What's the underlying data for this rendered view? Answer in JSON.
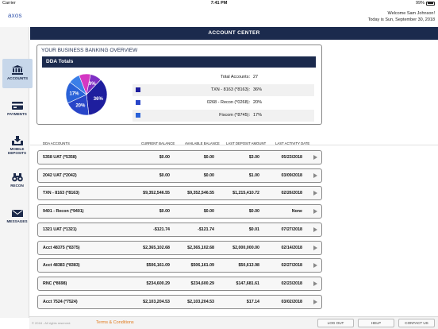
{
  "status_bar": {
    "carrier": "Carrier",
    "time": "7:41 PM",
    "battery": "99%"
  },
  "header": {
    "logo": "axos",
    "welcome_line1": "Welcome Sam Johnson!",
    "welcome_line2": "Today is Sun, September 30, 2018"
  },
  "nav": [
    {
      "label": "ACCOUNTS",
      "icon": "bank-icon",
      "active": true
    },
    {
      "label": "PAYMENTS",
      "icon": "payments-icon",
      "active": false
    },
    {
      "label": "MOBILE DEPOSITS",
      "icon": "mobile-deposit-icon",
      "active": false
    },
    {
      "label": "RECON",
      "icon": "binoculars-icon",
      "active": false
    },
    {
      "label": "MESSAGES",
      "icon": "envelope-icon",
      "active": false
    }
  ],
  "page_title": "ACCOUNT CENTER",
  "overview": {
    "title": "YOUR BUSINESS BANKING OVERVIEW",
    "section": "DDA Totals",
    "pie": [
      {
        "label": "9%",
        "value": 9,
        "color": "#7e2fc4"
      },
      {
        "label": "36%",
        "value": 36,
        "color": "#1e1e9e"
      },
      {
        "label": "20%",
        "value": 20,
        "color": "#2845c8"
      },
      {
        "label": "17%",
        "value": 17,
        "color": "#2a62d8"
      },
      {
        "label": "",
        "value": 9,
        "color": "#3b7fe8"
      },
      {
        "label": "",
        "value": 9,
        "color": "#d437c2"
      }
    ],
    "totals": [
      {
        "label": "Total Accounts:",
        "value": "27",
        "color": ""
      },
      {
        "label": "TXN - 8163 (*8163):",
        "value": "36%",
        "color": "#1e1e9e"
      },
      {
        "label": "0268 - Recon (*0268):",
        "value": "20%",
        "color": "#2845c8"
      },
      {
        "label": "Fiscom (*8745):",
        "value": "17%",
        "color": "#2a62d8"
      }
    ]
  },
  "columns": {
    "name": "DDA ACCOUNTS",
    "balance": "CURRENT BALANCE",
    "available": "AVAILABLE BALANCE",
    "deposit": "LAST DEPOSIT AMOUNT",
    "activity": "LAST ACTIVITY DATE"
  },
  "accounts": [
    {
      "name": "5358 UAT (*5358)",
      "balance": "$0.00",
      "available": "$0.00",
      "deposit": "$3.00",
      "date": "05/23/2018"
    },
    {
      "name": "2042 UAT (*2042)",
      "balance": "$0.00",
      "available": "$0.00",
      "deposit": "$1.00",
      "date": "03/09/2018"
    },
    {
      "name": "TXN - 8163 (*8163)",
      "balance": "$9,352,546.55",
      "available": "$9,352,546.55",
      "deposit": "$1,215,410.72",
      "date": "02/26/2018"
    },
    {
      "name": "9401 - Recon (*9401)",
      "balance": "$0.00",
      "available": "$0.00",
      "deposit": "$0.00",
      "date": "None"
    },
    {
      "name": "1321 UAT (*1321)",
      "balance": "-$121.74",
      "available": "-$121.74",
      "deposit": "$0.01",
      "date": "07/27/2018"
    },
    {
      "name": "Acct 48375 (*8375)",
      "balance": "$2,365,102.68",
      "available": "$2,365,102.68",
      "deposit": "$2,000,000.00",
      "date": "02/14/2018"
    },
    {
      "name": "Acct 48383 (*8383)",
      "balance": "$506,161.09",
      "available": "$506,161.09",
      "deposit": "$50,613.98",
      "date": "02/27/2018"
    },
    {
      "name": "RNC (*8698)",
      "balance": "$234,600.29",
      "available": "$234,600.29",
      "deposit": "$147,681.61",
      "date": "02/23/2018"
    },
    {
      "name": "Acct 7524 (*7524)",
      "balance": "$2,103,204.53",
      "available": "$2,103,204.53",
      "deposit": "$17.14",
      "date": "03/02/2018"
    }
  ],
  "footer": {
    "copyright": "© 2018 - All rights reserved.",
    "terms": "Terms & Conditions",
    "logout": "LOG OUT",
    "help": "HELP",
    "contact": "CONTACT US"
  }
}
